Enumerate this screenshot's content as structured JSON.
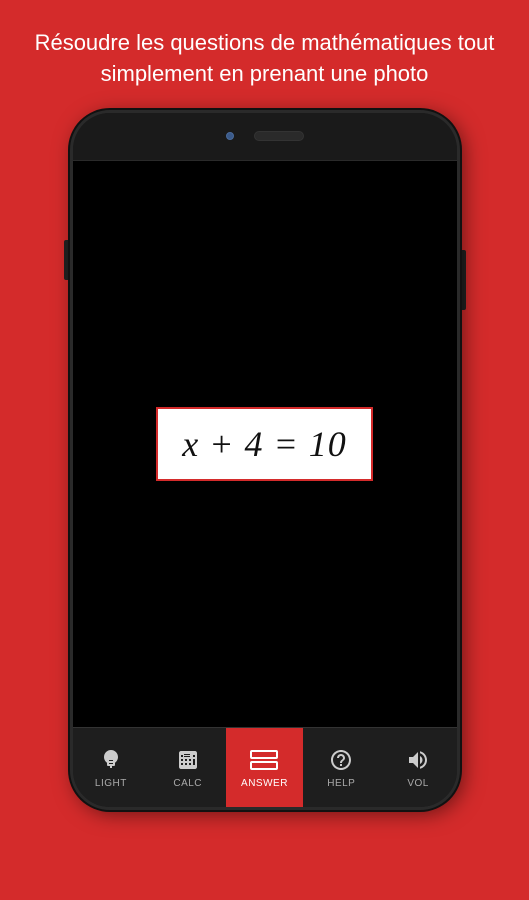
{
  "header": {
    "text": "Résoudre les questions de mathématiques tout simplement en prenant une photo"
  },
  "phone": {
    "camera_dot_color": "#3a5a8a"
  },
  "equation": {
    "display": "x + 4 = 10"
  },
  "nav": {
    "items": [
      {
        "id": "light",
        "label": "LIGHT",
        "icon": "bulb",
        "active": false
      },
      {
        "id": "calc",
        "label": "CALC",
        "icon": "calc",
        "active": false
      },
      {
        "id": "answer",
        "label": "ANSWER",
        "icon": "answer",
        "active": true
      },
      {
        "id": "help",
        "label": "HELP",
        "icon": "help",
        "active": false
      },
      {
        "id": "vol",
        "label": "VOL",
        "icon": "vol",
        "active": false
      }
    ]
  }
}
